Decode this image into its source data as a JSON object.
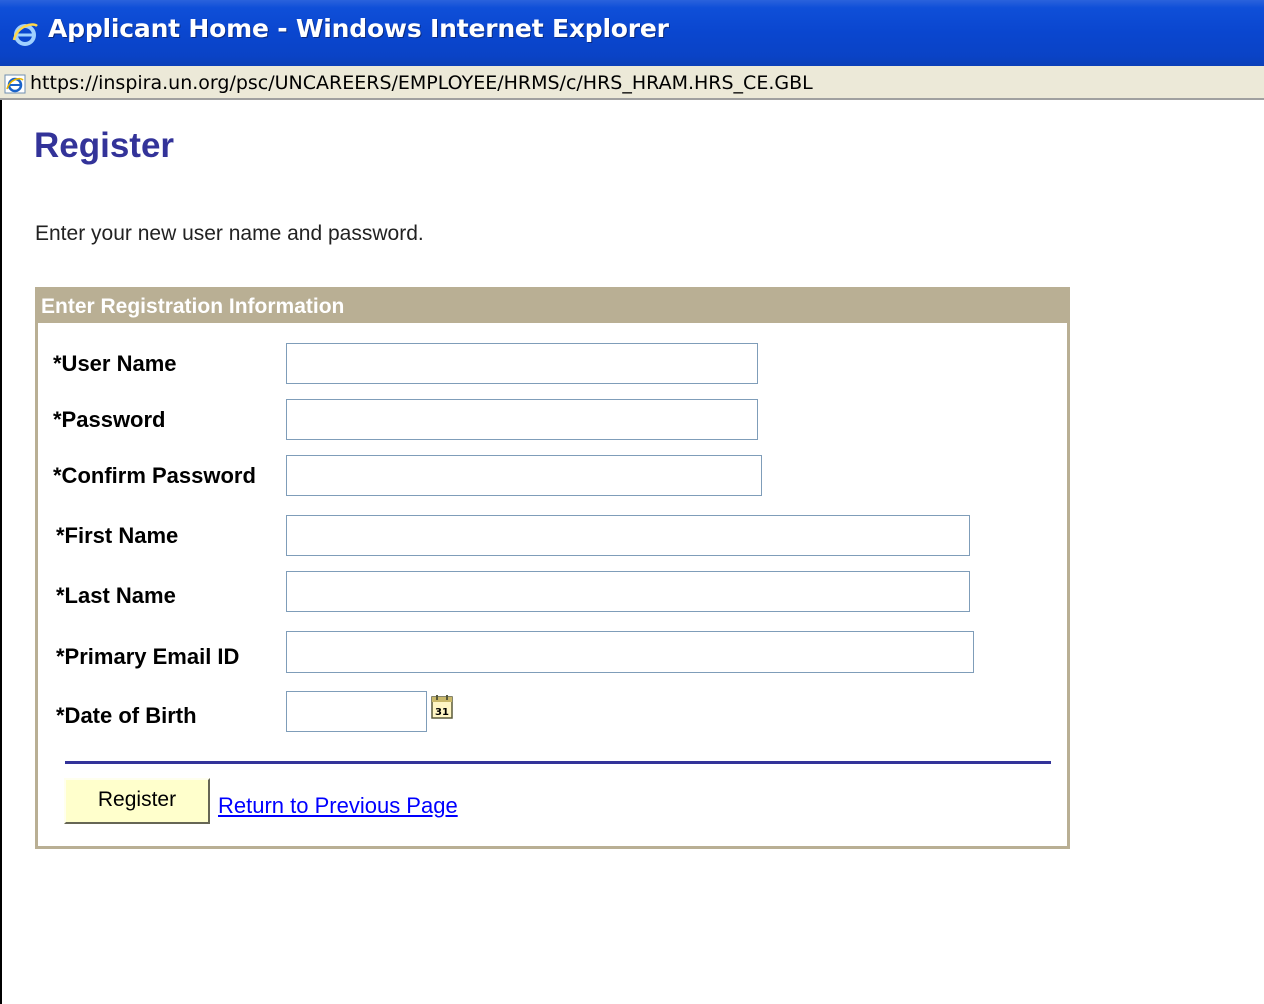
{
  "window": {
    "title": "Applicant Home - Windows Internet Explorer",
    "address": "https://inspira.un.org/psc/UNCAREERS/EMPLOYEE/HRMS/c/HRS_HRAM.HRS_CE.GBL",
    "icon": "ie-logo-icon"
  },
  "page": {
    "title": "Register",
    "instructions": "Enter your new user name and password."
  },
  "registration": {
    "header": "Enter Registration Information",
    "fields": {
      "user_name": {
        "label": "*User Name",
        "value": ""
      },
      "password": {
        "label": "*Password",
        "value": ""
      },
      "confirm_password": {
        "label": "*Confirm Password",
        "value": ""
      },
      "first_name": {
        "label": "*First Name",
        "value": ""
      },
      "last_name": {
        "label": "*Last Name",
        "value": ""
      },
      "primary_email": {
        "label": "*Primary Email ID",
        "value": ""
      },
      "date_of_birth": {
        "label": "*Date of Birth",
        "value": ""
      }
    },
    "calendar_icon": "calendar-icon",
    "calendar_day": "31",
    "register_button": "Register",
    "return_link": "Return to Previous Page"
  },
  "colors": {
    "titlebar": "#0a46cf",
    "page_title": "#333399",
    "box_border": "#b9af94",
    "button_bg": "#ffffcc",
    "link": "#0000ff"
  }
}
